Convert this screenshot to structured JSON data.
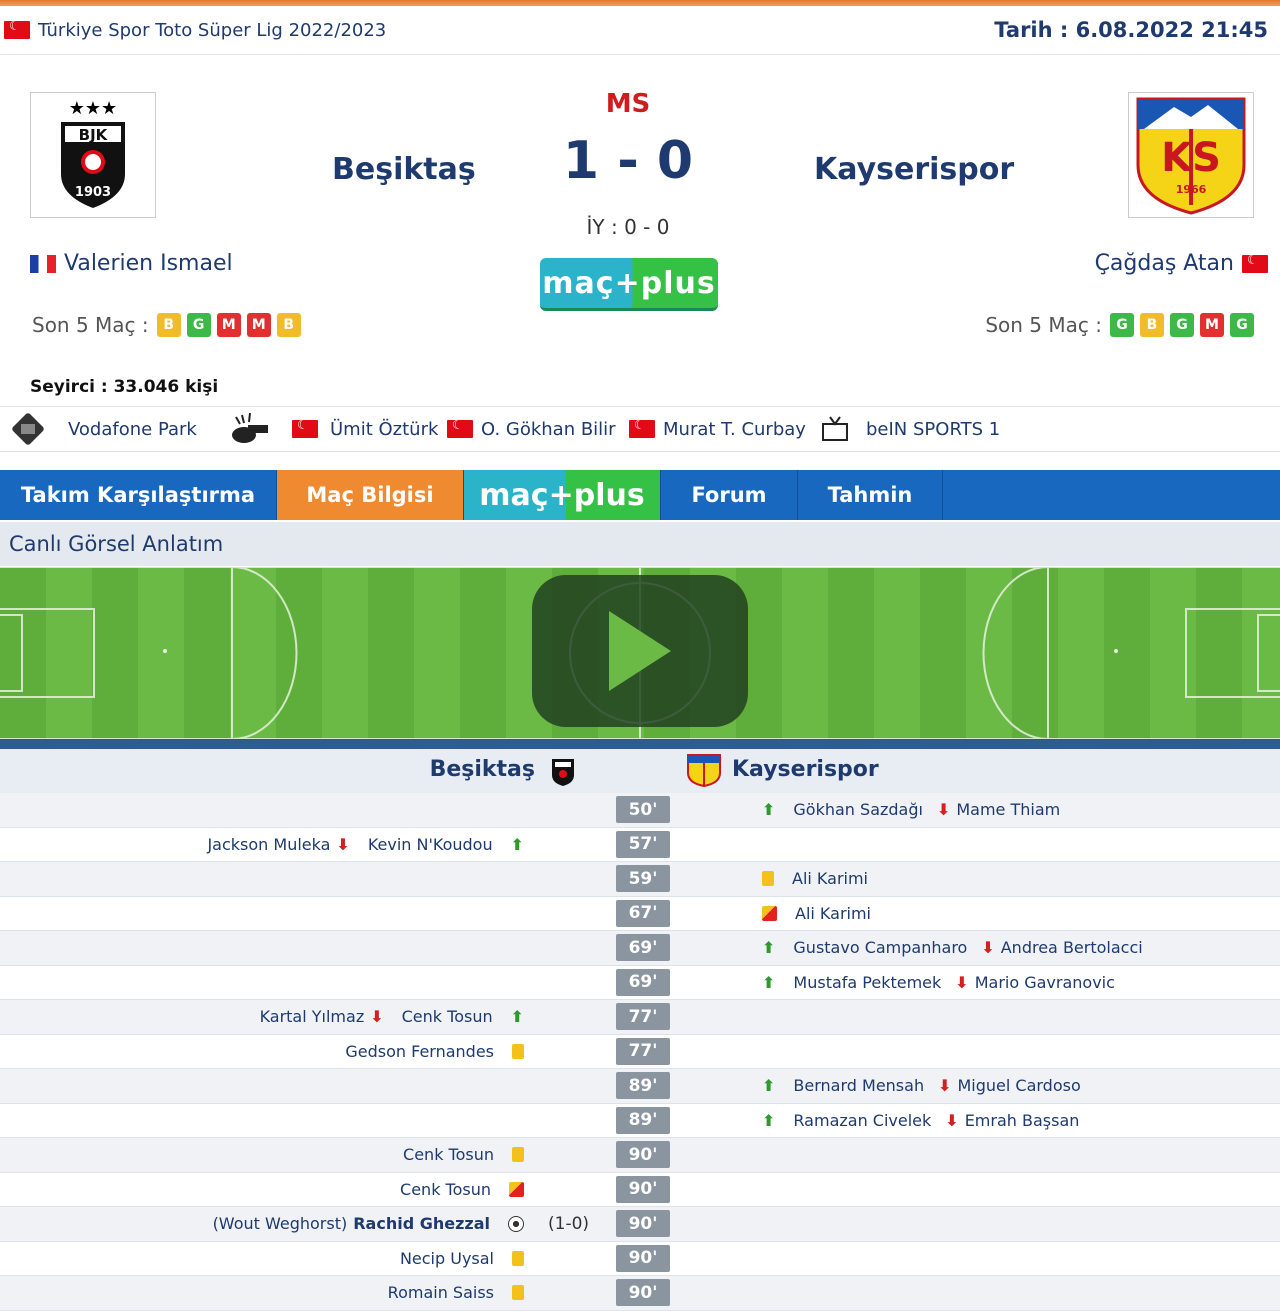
{
  "league": {
    "name": "Türkiye Spor Toto Süper Lig 2022/2023"
  },
  "date": "Tarih : 6.08.2022 21:45",
  "match": {
    "status": "MS",
    "score": "1 - 0",
    "halftime": "İY : 0 - 0",
    "home_team": "Beşiktaş",
    "away_team": "Kayserispor",
    "home_coach": "Valerien Ismael",
    "away_coach": "Çağdaş Atan",
    "last5_label": "Son 5 Maç :",
    "home_form": [
      "B",
      "G",
      "M",
      "M",
      "B"
    ],
    "away_form": [
      "G",
      "B",
      "G",
      "M",
      "G"
    ],
    "home_logo_text": "BJK",
    "home_logo_year": "1903",
    "away_logo_text": "KS",
    "away_logo_year": "1966",
    "crowd": "Seyirci : 33.046 kişi",
    "macplus": "maç+plus"
  },
  "info": {
    "stadium": "Vodafone Park",
    "referee": "Ümit Öztürk",
    "assistant1": "O. Gökhan Bilir",
    "assistant2": "Murat T. Curbay",
    "broadcaster": "beIN SPORTS 1"
  },
  "tabs": [
    "Takım Karşılaştırma",
    "Maç Bilgisi",
    "maç+plus",
    "Forum",
    "Tahmin"
  ],
  "section_title": "Canlı Görsel Anlatım",
  "events_header": {
    "home": "Beşiktaş",
    "away": "Kayserispor"
  },
  "events": [
    {
      "minute": "50'",
      "side": "away",
      "type": "sub",
      "in": "Gökhan Sazdağı",
      "out": "Mame Thiam"
    },
    {
      "minute": "57'",
      "side": "home",
      "type": "sub",
      "in": "Kevin N'Koudou",
      "out": "Jackson Muleka"
    },
    {
      "minute": "59'",
      "side": "away",
      "type": "yellow",
      "player": "Ali Karimi"
    },
    {
      "minute": "67'",
      "side": "away",
      "type": "yellowred",
      "player": "Ali Karimi"
    },
    {
      "minute": "69'",
      "side": "away",
      "type": "sub",
      "in": "Gustavo Campanharo",
      "out": "Andrea Bertolacci"
    },
    {
      "minute": "69'",
      "side": "away",
      "type": "sub",
      "in": "Mustafa Pektemek",
      "out": "Mario Gavranovic"
    },
    {
      "minute": "77'",
      "side": "home",
      "type": "sub",
      "in": "Cenk Tosun",
      "out": "Kartal Yılmaz"
    },
    {
      "minute": "77'",
      "side": "home",
      "type": "yellow",
      "player": "Gedson Fernandes"
    },
    {
      "minute": "89'",
      "side": "away",
      "type": "sub",
      "in": "Bernard Mensah",
      "out": "Miguel Cardoso"
    },
    {
      "minute": "89'",
      "side": "away",
      "type": "sub",
      "in": "Ramazan Civelek",
      "out": "Emrah Başsan"
    },
    {
      "minute": "90'",
      "side": "home",
      "type": "yellow",
      "player": "Cenk Tosun"
    },
    {
      "minute": "90'",
      "side": "home",
      "type": "yellowred",
      "player": "Cenk Tosun"
    },
    {
      "minute": "90'",
      "side": "home",
      "type": "goal",
      "assist": "(Wout Weghorst)",
      "player": "Rachid Ghezzal",
      "score": "(1-0)"
    },
    {
      "minute": "90'",
      "side": "home",
      "type": "yellow",
      "player": "Necip Uysal"
    },
    {
      "minute": "90'",
      "side": "home",
      "type": "yellow",
      "player": "Romain Saiss"
    }
  ],
  "colors": {
    "navy": "#1e3a6e",
    "tab_blue": "#1868c0",
    "tab_orange": "#f08a30",
    "red": "#d01c1c"
  }
}
